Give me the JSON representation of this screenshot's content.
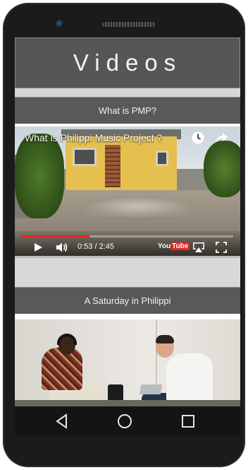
{
  "header": {
    "title": "Videos"
  },
  "videos": [
    {
      "section_title": "What is PMP?",
      "video_title": "What is Philippi Music Project ?",
      "time": "0:53 / 2:45",
      "progress": 0.32,
      "logo_you": "You",
      "logo_tube": "Tube"
    },
    {
      "section_title": "A Saturday in Philippi"
    }
  ],
  "colors": {
    "header_bg": "#565656",
    "section_bg": "#595959",
    "progress": "#e52620"
  },
  "icons": [
    "clock-icon",
    "share-icon",
    "play-icon",
    "volume-icon",
    "airplay-icon",
    "fullscreen-icon",
    "back-icon",
    "home-icon",
    "recents-icon"
  ]
}
